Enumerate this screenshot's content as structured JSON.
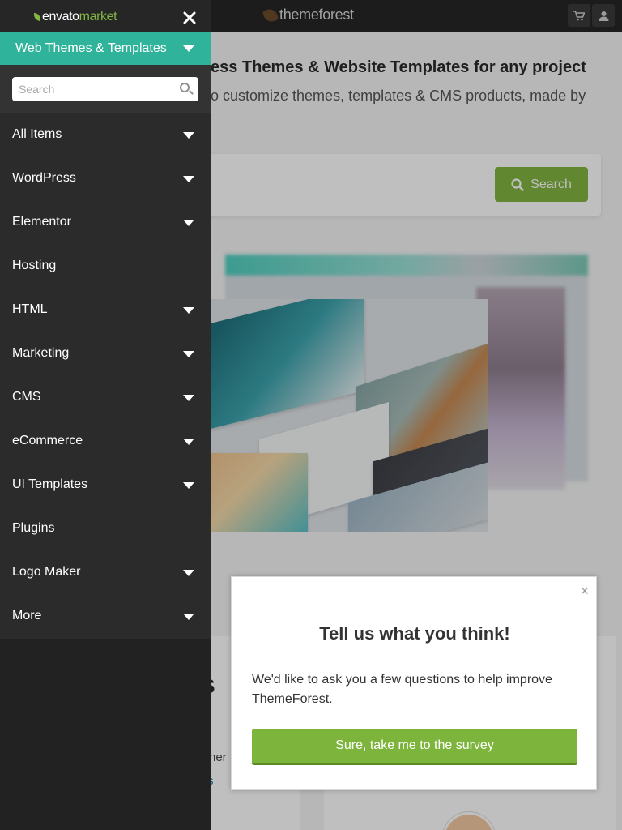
{
  "background_page": {
    "site_name": "themeforest",
    "cart_icon": "cart-icon",
    "user_icon": "user-icon",
    "hero_title_fragment": "ess Themes & Website Templates for any project",
    "hero_subtitle_fragment": "o customize themes, templates & CMS products, made by",
    "search_button_label": "Search",
    "section_heading_fragment": "s",
    "text_fragment_1": "her",
    "link_fragment": "s"
  },
  "drawer": {
    "brand_part1": "envato",
    "brand_part2": "market",
    "close_icon": "close-icon",
    "category_selector": "Web Themes & Templates",
    "search_placeholder": "Search",
    "items": [
      {
        "label": "All Items",
        "has_dropdown": true
      },
      {
        "label": "WordPress",
        "has_dropdown": true
      },
      {
        "label": "Elementor",
        "has_dropdown": true
      },
      {
        "label": "Hosting",
        "has_dropdown": false
      },
      {
        "label": "HTML",
        "has_dropdown": true
      },
      {
        "label": "Marketing",
        "has_dropdown": true
      },
      {
        "label": "CMS",
        "has_dropdown": true
      },
      {
        "label": "eCommerce",
        "has_dropdown": true
      },
      {
        "label": "UI Templates",
        "has_dropdown": true
      },
      {
        "label": "Plugins",
        "has_dropdown": false
      },
      {
        "label": "Logo Maker",
        "has_dropdown": true
      },
      {
        "label": "More",
        "has_dropdown": true
      }
    ]
  },
  "feedback_modal": {
    "close_symbol": "×",
    "title": "Tell us what you think!",
    "body": "We'd like to ask you a few questions to help improve ThemeForest.",
    "cta_label": "Sure, take me to the survey"
  },
  "colors": {
    "drawer_bg": "#222222",
    "menu_bg": "#2b2b2b",
    "category_accent": "#2fb39a",
    "cta_green": "#7cb43c",
    "brand_green": "#82b541"
  }
}
